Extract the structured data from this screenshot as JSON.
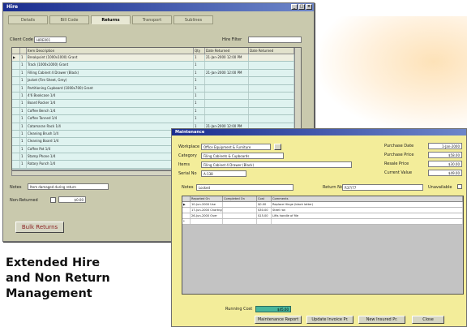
{
  "colors": {
    "window_bg": "#c9c9ad",
    "grid_bg": "#dff3f0",
    "maint_bg": "#f3ed9a",
    "titlebar": "#1a2d8f",
    "running_cost": "#48b59c"
  },
  "hire_window": {
    "title": "Hire",
    "tabs": [
      "Details",
      "Bill Code",
      "Returns",
      "Transport",
      "Sublines"
    ],
    "client_code_label": "Client Code",
    "client_code_value": "HIRE001",
    "filter_label": "Hire Filter",
    "filter_value": "",
    "columns": [
      "Item Description",
      "Qty",
      "Date Returned",
      "Date Returned"
    ],
    "rows": [
      {
        "num": "1",
        "desc": "Breakpoint (1000x1000) Grant",
        "qty": "1",
        "date": "21-Jan-2000 12:00 PM"
      },
      {
        "num": "1",
        "desc": "Track (1000x1000) Grant",
        "qty": "1",
        "date": ""
      },
      {
        "num": "1",
        "desc": "Filling Cabinet 4 Drawer (Black)",
        "qty": "1",
        "date": "21-Jan-2000 12:00 PM"
      },
      {
        "num": "1",
        "desc": "Jacket (Fire Sheet, Grey)",
        "qty": "1",
        "date": ""
      },
      {
        "num": "1",
        "desc": "Partitioning Cupboard (1000x700) Grant",
        "qty": "1",
        "date": ""
      },
      {
        "num": "1",
        "desc": "4'6 Bookcase 1/4",
        "qty": "1",
        "date": ""
      },
      {
        "num": "1",
        "desc": "Board Rocker 1/4",
        "qty": "1",
        "date": ""
      },
      {
        "num": "1",
        "desc": "Coffee Bench 1/4",
        "qty": "1",
        "date": ""
      },
      {
        "num": "1",
        "desc": "Coffee Tanned 1/4",
        "qty": "1",
        "date": ""
      },
      {
        "num": "1",
        "desc": "Catamaran Rack 1/4",
        "qty": "1",
        "date": "21-Jan-2000 12:00 PM"
      },
      {
        "num": "1",
        "desc": "Cleaning Brush 1/4",
        "qty": "1",
        "date": ""
      },
      {
        "num": "1",
        "desc": "Cleaning Board 1/4",
        "qty": "1",
        "date": ""
      },
      {
        "num": "1",
        "desc": "Coffee Pot 1/4",
        "qty": "1",
        "date": ""
      },
      {
        "num": "1",
        "desc": "Stamp Phone 1/4",
        "qty": "1",
        "date": ""
      },
      {
        "num": "1",
        "desc": "Rotary Punch 1/4",
        "qty": "1",
        "date": ""
      }
    ],
    "notes_label": "Notes",
    "notes_value": "Item damaged during return",
    "non_returned_label": "Non-Returned",
    "non_returned_value": "$0.00",
    "bulk_button": "Bulk Returns"
  },
  "caption": {
    "line1": "Extended Hire",
    "line2": "and Non Return",
    "line3": "Management"
  },
  "maint_window": {
    "title": "Maintenance",
    "fields": [
      {
        "label": "Workplace",
        "value": "Office Equipment & Furniture"
      },
      {
        "label": "Category",
        "value": "Filing Cabinets & Cupboards"
      },
      {
        "label": "Items",
        "value": "Filing Cabinet 4 Drawer (Black)"
      },
      {
        "label": "Serial No",
        "value": "A-138"
      }
    ],
    "right_fields": [
      {
        "label": "Purchase Date",
        "value": "1-Jan-2000"
      },
      {
        "label": "Purchase Price",
        "value": "$58.00"
      },
      {
        "label": "Resale Price",
        "value": "$30.00"
      },
      {
        "label": "Current Value",
        "value": "$49.00"
      }
    ],
    "notes_label": "Notes",
    "notes_value": "Locked",
    "return_label": "Return No",
    "return_value": "R37/77",
    "unavailable_label": "Unavailable",
    "columns": [
      "Reported On",
      "Completed On",
      "Cost",
      "Comments"
    ],
    "rows": [
      {
        "reported": "10-Jun-2000 Use",
        "completed": "",
        "cost": "$0.00",
        "comment": "Replace Hinge (black latter)"
      },
      {
        "reported": "17-Jun-2000 Chartngulate",
        "completed": "",
        "cost": "$30.00",
        "comment": "Steel ran"
      },
      {
        "reported": "26-Jun-2000 Over",
        "completed": "",
        "cost": "$15.00",
        "comment": "Lifts handle of file"
      }
    ],
    "running_cost_label": "Running Cost",
    "running_cost_value": "$45.00",
    "buttons": [
      "Maintenance Report",
      "Update Invoice Pr.",
      "New Insured Pr.",
      "Close"
    ]
  }
}
